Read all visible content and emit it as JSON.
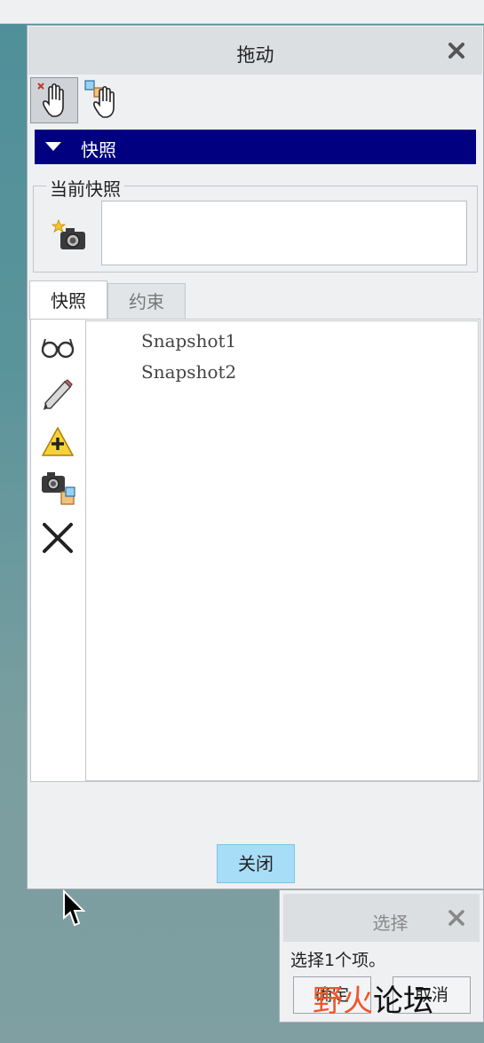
{
  "dialog": {
    "title": "拖动",
    "section_header": "快照",
    "current_snapshot_group": "当前快照",
    "tabs": [
      {
        "label": "快照",
        "active": true
      },
      {
        "label": "约束",
        "active": false
      }
    ],
    "snapshots": [
      "Snapshot1",
      "Snapshot2"
    ],
    "close_button": "关闭",
    "current_snapshot_value": ""
  },
  "select_dialog": {
    "title": "选择",
    "message": "选择1个项。",
    "ok_button": "确定",
    "cancel_button": "取消"
  },
  "watermark": {
    "part1": "野火",
    "part2": "论坛"
  },
  "icons": {
    "toolbar": [
      "drag-hand-icon",
      "drag-parts-hand-icon"
    ],
    "side": [
      "glasses-icon",
      "pencil-icon",
      "add-warning-icon",
      "camera-copy-icon",
      "delete-x-icon"
    ],
    "capture": "camera-star-icon"
  },
  "colors": {
    "section_header": "#000080",
    "close_button": "#a8ddf8",
    "watermark_red": "#f0552a"
  }
}
